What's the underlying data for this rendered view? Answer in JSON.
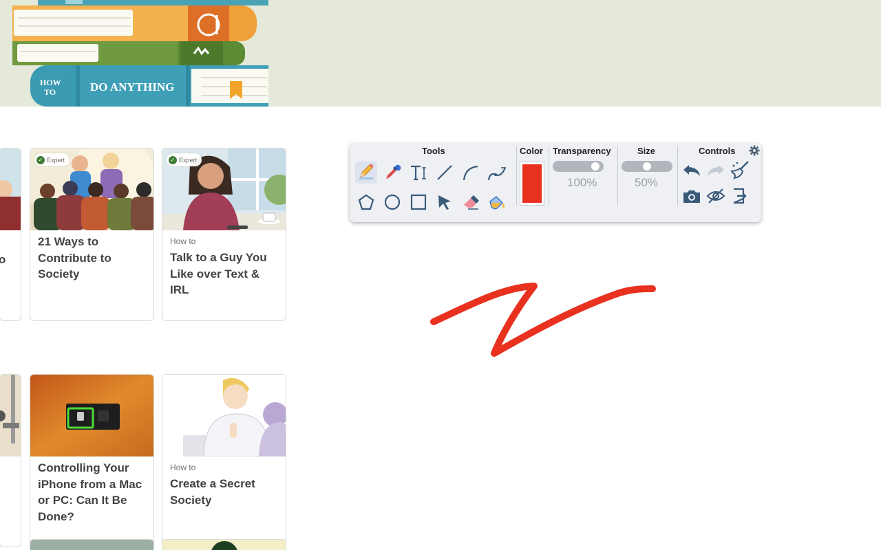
{
  "banner": {
    "book_text_how": "HOW",
    "book_text_to": "TO",
    "book_text_main": "DO ANYTHING"
  },
  "cards": [
    {
      "badge": "Expert",
      "prefix": "",
      "title": "21 Ways to Contribute to Society"
    },
    {
      "badge": "Expert",
      "prefix": "How to",
      "title": "Talk to a Guy You Like over Text & IRL"
    },
    {
      "badge": "",
      "prefix": "",
      "title": "Controlling Your iPhone from a Mac or PC: Can It Be Done?"
    },
    {
      "badge": "",
      "prefix": "How to",
      "title": "Create a Secret Society"
    }
  ],
  "partial_card": {
    "fragment": "o"
  },
  "toolbar": {
    "tools_label": "Tools",
    "color_label": "Color",
    "transparency_label": "Transparency",
    "size_label": "Size",
    "controls_label": "Controls",
    "transparency_value": "100%",
    "size_value": "50%",
    "transparency_level": 1.0,
    "size_level": 0.5,
    "selected_color": "#e9311f",
    "tools": [
      "pencil-icon",
      "eyedropper-icon",
      "text-icon",
      "line-icon",
      "arc-icon",
      "curve-icon",
      "polygon-icon",
      "circle-icon",
      "rectangle-icon",
      "pointer-icon",
      "eraser-icon",
      "fill-bucket-icon"
    ],
    "controls": [
      "undo-icon",
      "redo-icon",
      "clear-icon",
      "camera-icon",
      "hide-icon",
      "exit-icon",
      "gear-icon"
    ]
  },
  "colors": {
    "banner_bg": "#e4e9da",
    "drawing_stroke": "#e9311f",
    "toolbar_bg": "#eef0f3",
    "icon_blue": "#3a5a7a"
  }
}
